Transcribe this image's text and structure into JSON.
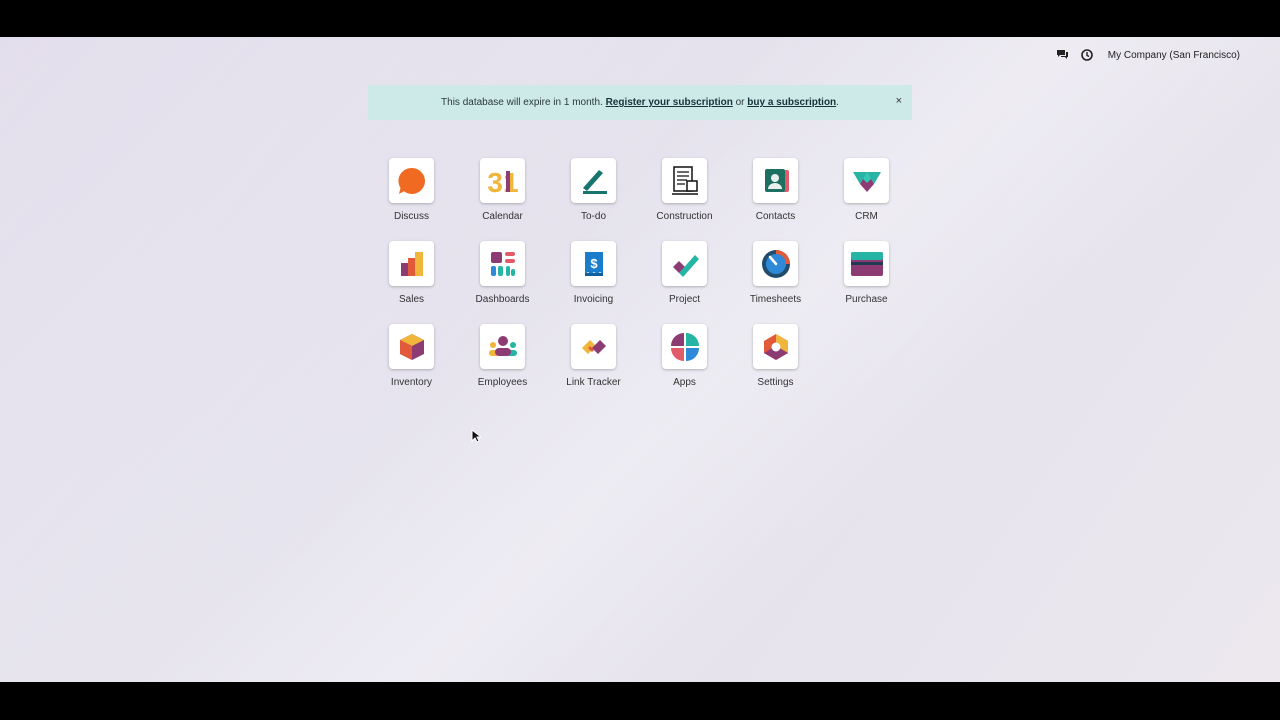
{
  "topbar": {
    "company": "My Company (San Francisco)",
    "icons": [
      "chat-icon",
      "clock-icon"
    ]
  },
  "banner": {
    "text_before": "This database will expire in 1 month. ",
    "register_link": "Register your subscription",
    "text_middle": " or ",
    "buy_link": "buy a subscription",
    "text_after": ".",
    "close": "×",
    "bg_color": "#cde9e8"
  },
  "apps": [
    {
      "label": "Discuss",
      "icon": "discuss-icon"
    },
    {
      "label": "Calendar",
      "icon": "calendar-icon",
      "glyph": "31"
    },
    {
      "label": "To-do",
      "icon": "todo-icon"
    },
    {
      "label": "Construction",
      "icon": "construction-icon"
    },
    {
      "label": "Contacts",
      "icon": "contacts-icon"
    },
    {
      "label": "CRM",
      "icon": "crm-icon"
    },
    {
      "label": "Sales",
      "icon": "sales-icon"
    },
    {
      "label": "Dashboards",
      "icon": "dashboards-icon"
    },
    {
      "label": "Invoicing",
      "icon": "invoicing-icon",
      "glyph": "$"
    },
    {
      "label": "Project",
      "icon": "project-icon"
    },
    {
      "label": "Timesheets",
      "icon": "timesheets-icon"
    },
    {
      "label": "Purchase",
      "icon": "purchase-icon"
    },
    {
      "label": "Inventory",
      "icon": "inventory-icon"
    },
    {
      "label": "Employees",
      "icon": "employees-icon"
    },
    {
      "label": "Link Tracker",
      "icon": "link-tracker-icon"
    },
    {
      "label": "Apps",
      "icon": "apps-icon"
    },
    {
      "label": "Settings",
      "icon": "settings-icon"
    }
  ]
}
